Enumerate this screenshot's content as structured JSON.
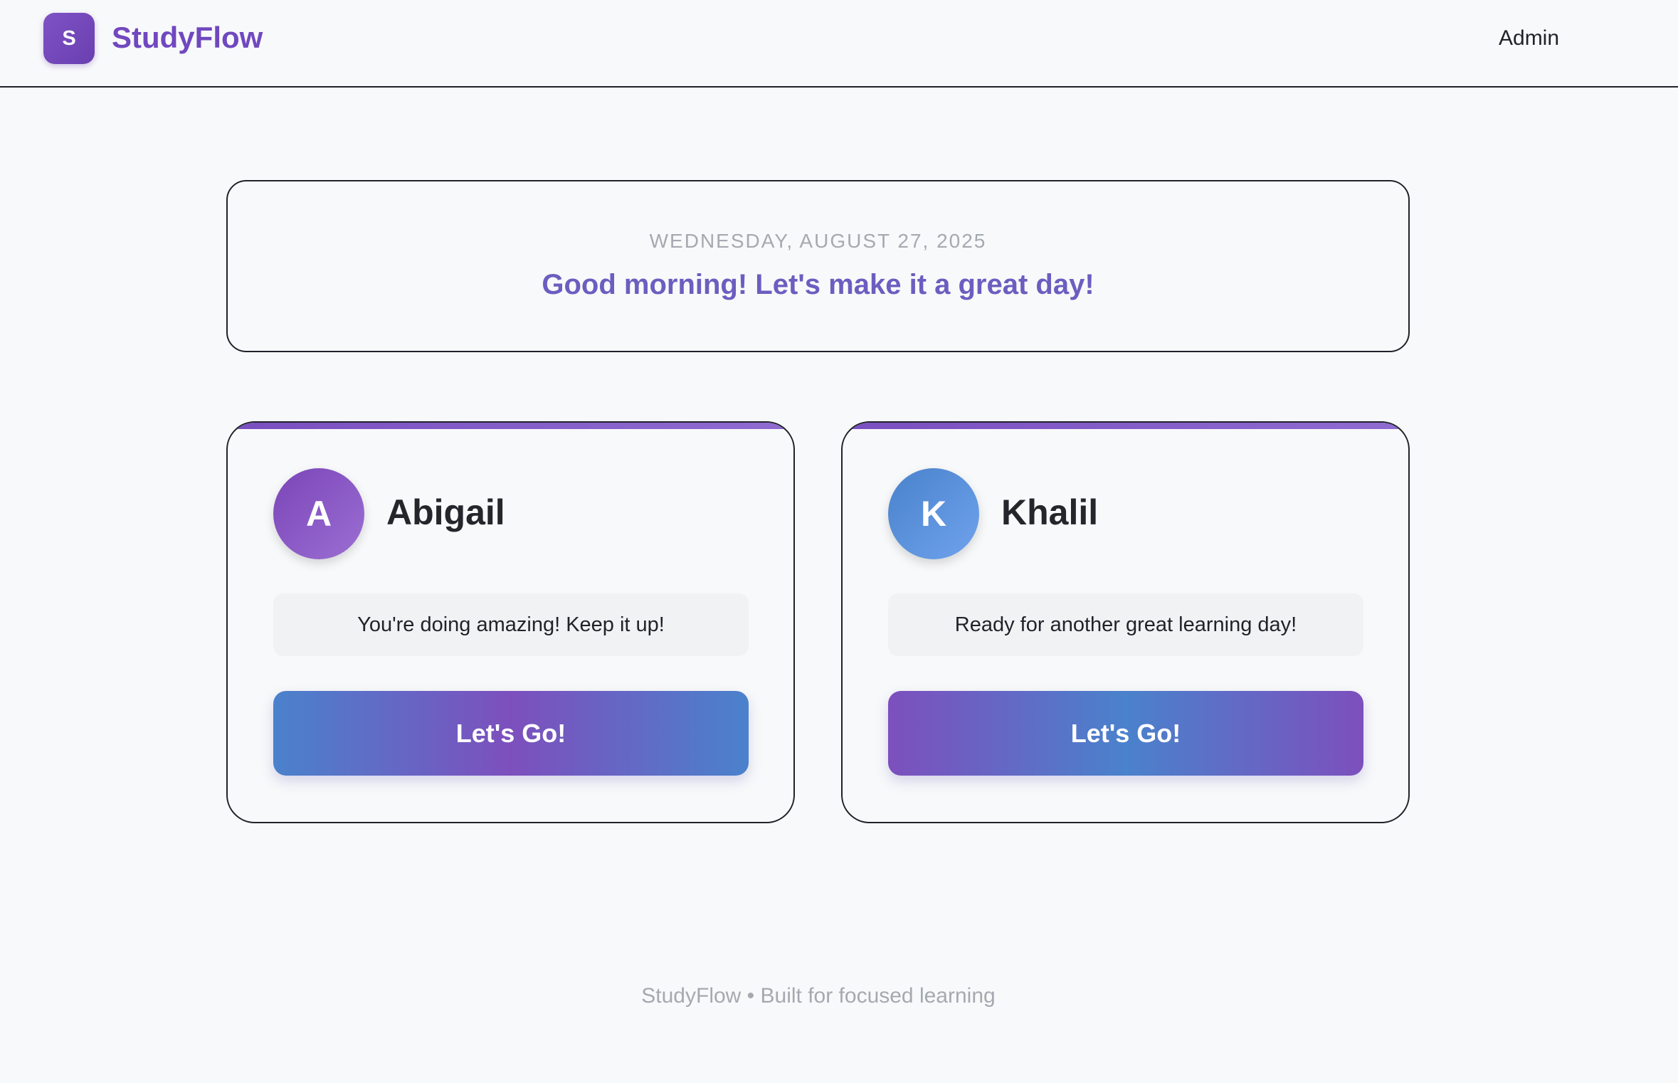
{
  "header": {
    "logo_letter": "S",
    "brand": "StudyFlow",
    "admin_label": "Admin"
  },
  "greeting": {
    "date": "WEDNESDAY, AUGUST 27, 2025",
    "message": "Good morning! Let's make it a great day!"
  },
  "students": [
    {
      "initial": "A",
      "name": "Abigail",
      "message": "You're doing amazing! Keep it up!",
      "button_label": "Let's Go!"
    },
    {
      "initial": "K",
      "name": "Khalil",
      "message": "Ready for another great learning day!",
      "button_label": "Let's Go!"
    }
  ],
  "footer": {
    "text": "StudyFlow • Built for focused learning"
  },
  "colors": {
    "brand": "#7048bf",
    "greeting": "#6a5ec0",
    "avatar_purple": "#8a5cc8",
    "avatar_blue": "#5a92dc"
  }
}
